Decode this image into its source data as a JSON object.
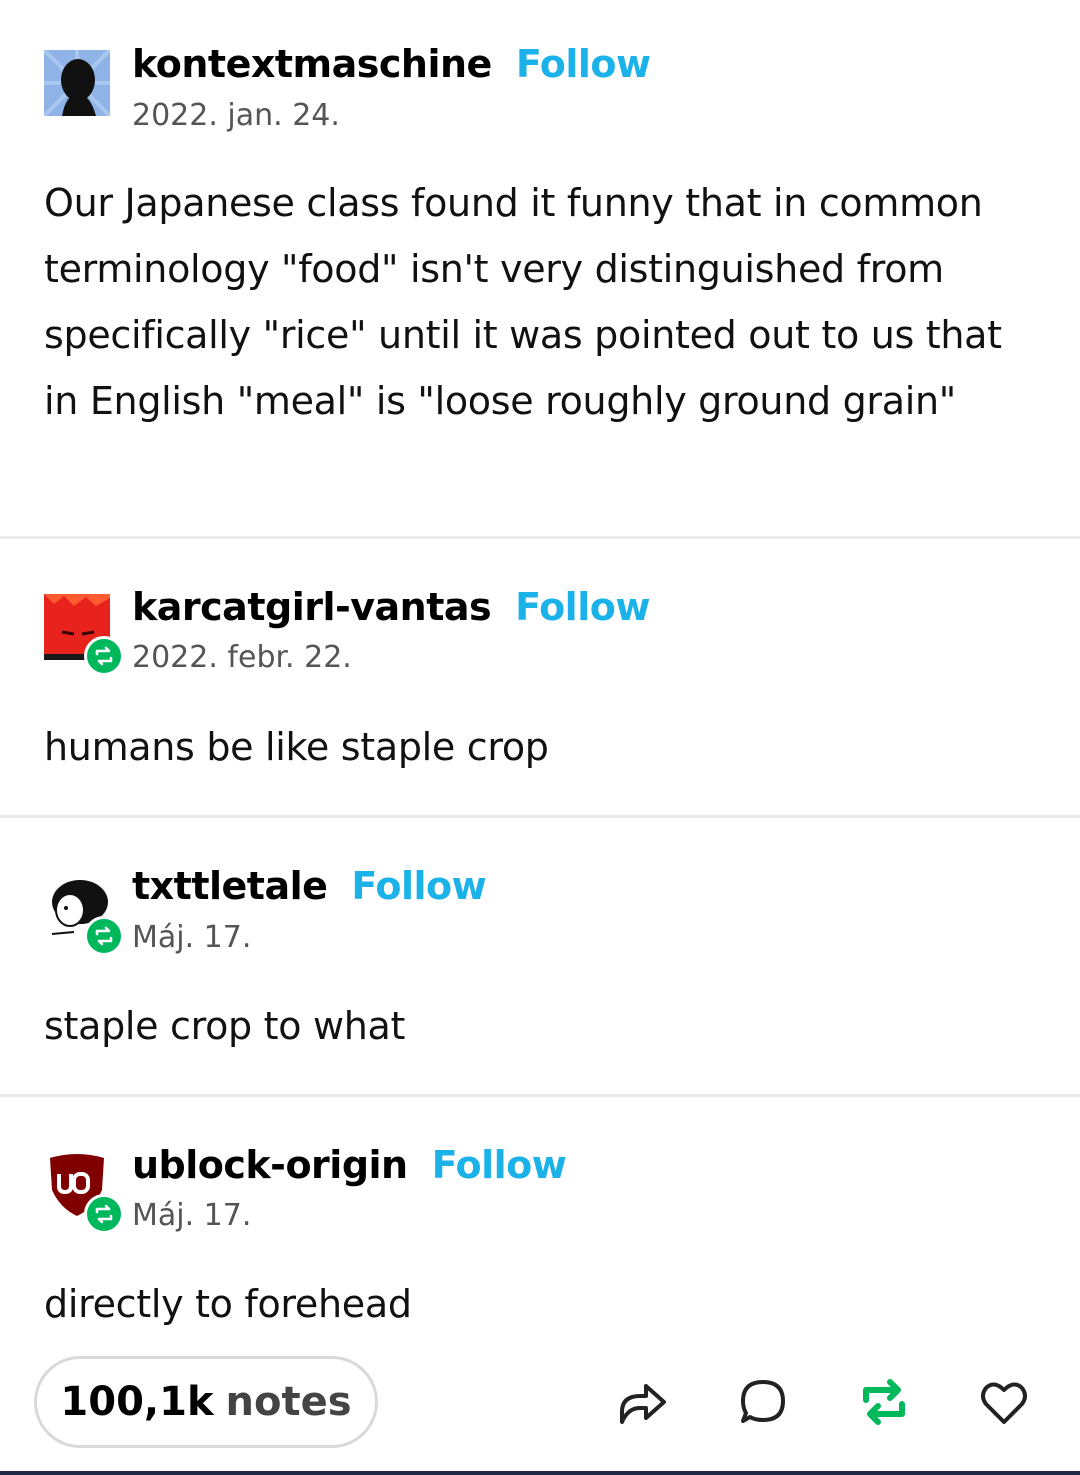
{
  "posts": [
    {
      "username": "kontextmaschine",
      "follow_label": "Follow",
      "date": "2022. jan. 24.",
      "text": "Our Japanese class found it funny that in common terminology \"food\" isn't very distinguished from specifically \"rice\" until it was pointed out to us that in English \"meal\" is \"loose roughly ground grain\""
    },
    {
      "username": "karcatgirl-vantas",
      "follow_label": "Follow",
      "date": "2022. febr. 22.",
      "text": "humans be like staple crop"
    },
    {
      "username": "txttletale",
      "follow_label": "Follow",
      "date": "Máj. 17.",
      "text": "staple crop to what"
    },
    {
      "username": "ublock-origin",
      "follow_label": "Follow",
      "date": "Máj. 17.",
      "text": "directly to forehead"
    }
  ],
  "footer": {
    "notes_count": "100,1k",
    "notes_label": "notes"
  },
  "colors": {
    "follow": "#1ab2e8",
    "reblog_badge": "#00b85c",
    "reblog_action": "#00b85c"
  }
}
